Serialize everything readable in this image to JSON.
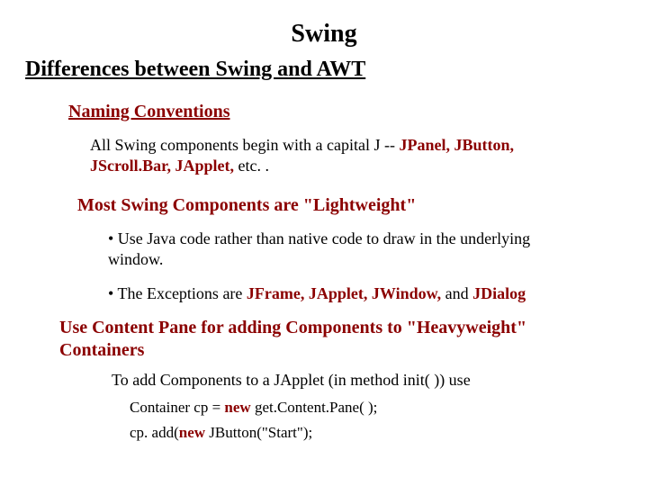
{
  "title": "Swing",
  "subtitle": "Differences between Swing and AWT",
  "heading_naming": "Naming Conventions",
  "para_naming_pre": "All Swing components begin with a capital J  -- ",
  "para_naming_bold": "JPanel, JButton, JScroll.Bar, JApplet,",
  "para_naming_post": " etc. .",
  "heading_lightweight": "Most Swing Components are \"Lightweight\"",
  "bullet1": "• Use Java code rather than native code to draw in the underlying window.",
  "bullet2_pre": "• The Exceptions are ",
  "bullet2_b1": "JFrame, JApplet, JWindow,",
  "bullet2_mid": " and ",
  "bullet2_b2": "JDialog",
  "heading_contentpane": "Use Content Pane for adding Components to \"Heavyweight\" Containers",
  "para_add": "To add Components to a JApplet (in method init( )) use",
  "code1_pre": "Container cp = ",
  "code1_b": "new",
  "code1_post": " get.Content.Pane( );",
  "code2_pre": "cp. add(",
  "code2_b": "new",
  "code2_post": " JButton(\"Start\");"
}
